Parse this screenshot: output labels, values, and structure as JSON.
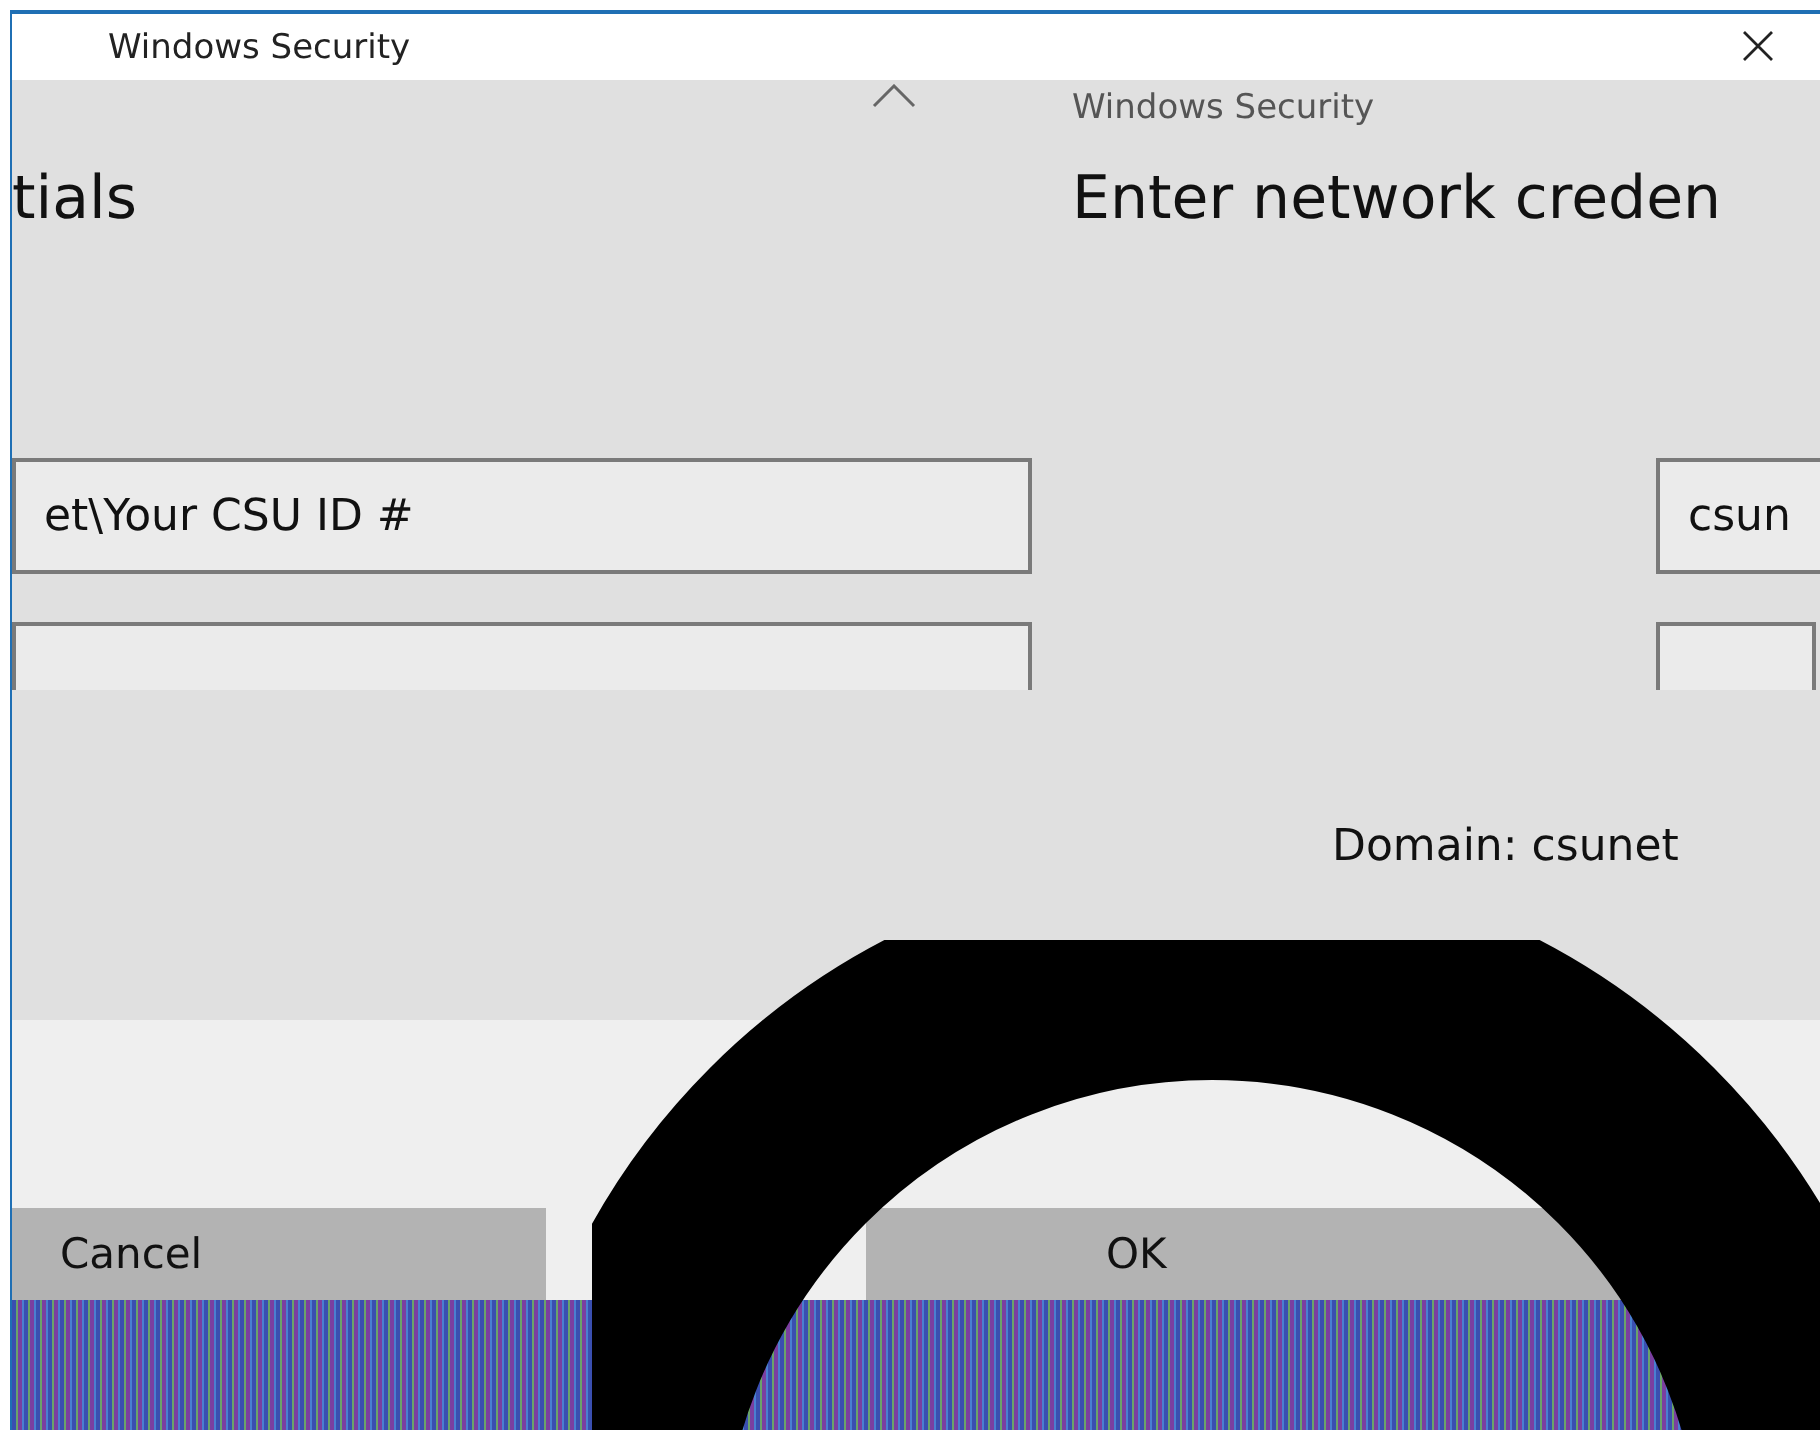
{
  "window": {
    "title": "Windows Security"
  },
  "left_panel": {
    "heading": "tials",
    "username": "et\\Your CSU ID #",
    "button": "Cancel"
  },
  "right_panel": {
    "subtitle": "Windows Security",
    "heading": "Enter network creden",
    "username": "csun",
    "domain": "Domain: csunet",
    "button": "OK"
  }
}
